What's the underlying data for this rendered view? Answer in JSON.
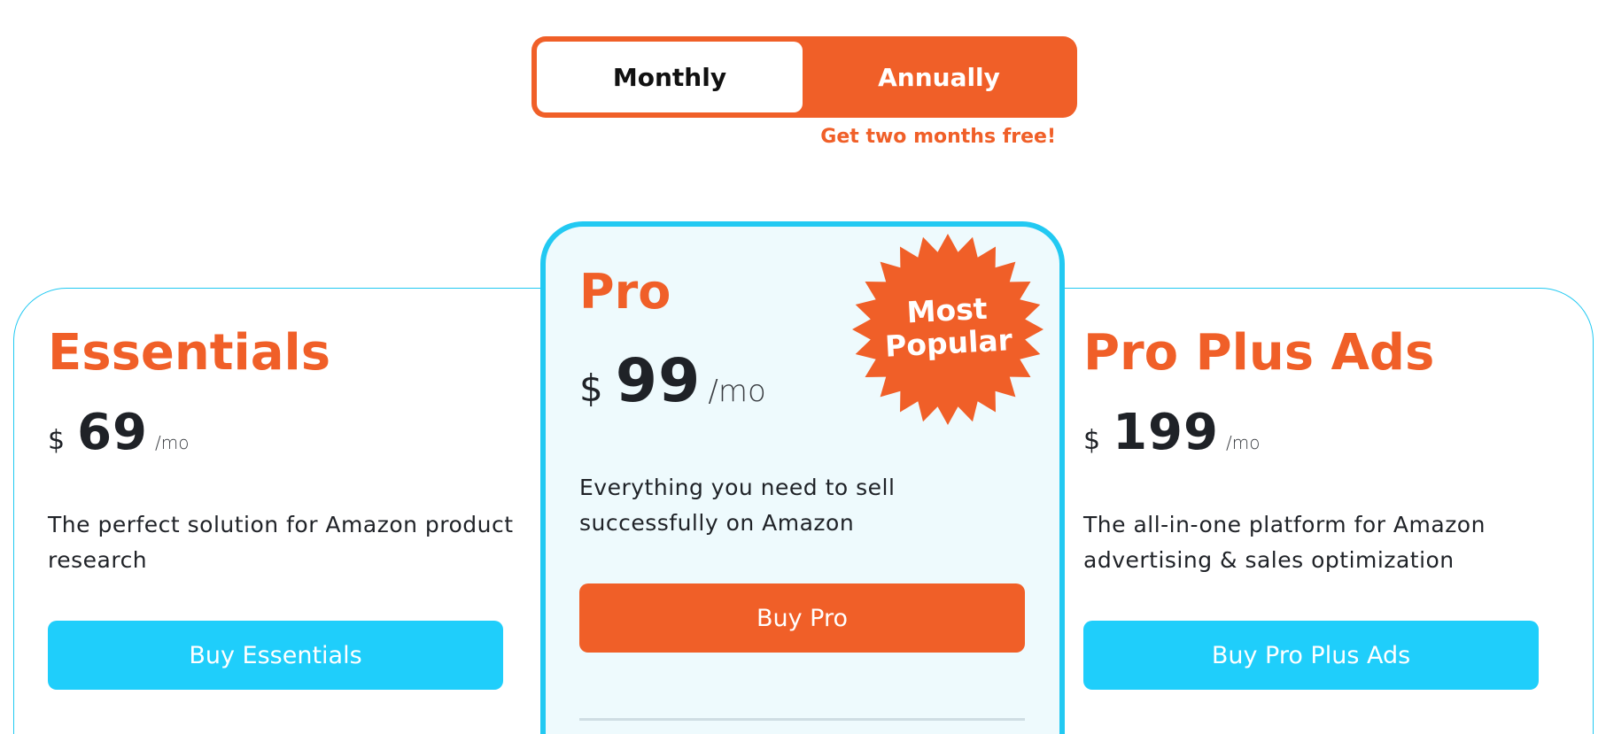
{
  "billing_toggle": {
    "monthly_label": "Monthly",
    "annually_label": "Annually",
    "selected": "Monthly",
    "promo_text": "Get two months free!"
  },
  "plans": [
    {
      "name": "Essentials",
      "currency": "$",
      "price": "69",
      "period": "/mo",
      "description": "The perfect solution for Amazon product research",
      "button_label": "Buy Essentials"
    },
    {
      "name": "Pro",
      "currency": "$",
      "price": "99",
      "period": "/mo",
      "description": "Everything you need to sell successfully on Amazon",
      "button_label": "Buy Pro",
      "badge": "Most Popular"
    },
    {
      "name": "Pro Plus Ads",
      "currency": "$",
      "price": "199",
      "period": "/mo",
      "description": "The all-in-one platform for Amazon advertising & sales optimization",
      "button_label": "Buy Pro Plus Ads"
    }
  ],
  "colors": {
    "accent_orange": "#f05f28",
    "accent_blue": "#1fcefb",
    "featured_bg": "#eefafd"
  },
  "icons": {
    "badge_shape": "starburst-badge-icon"
  }
}
